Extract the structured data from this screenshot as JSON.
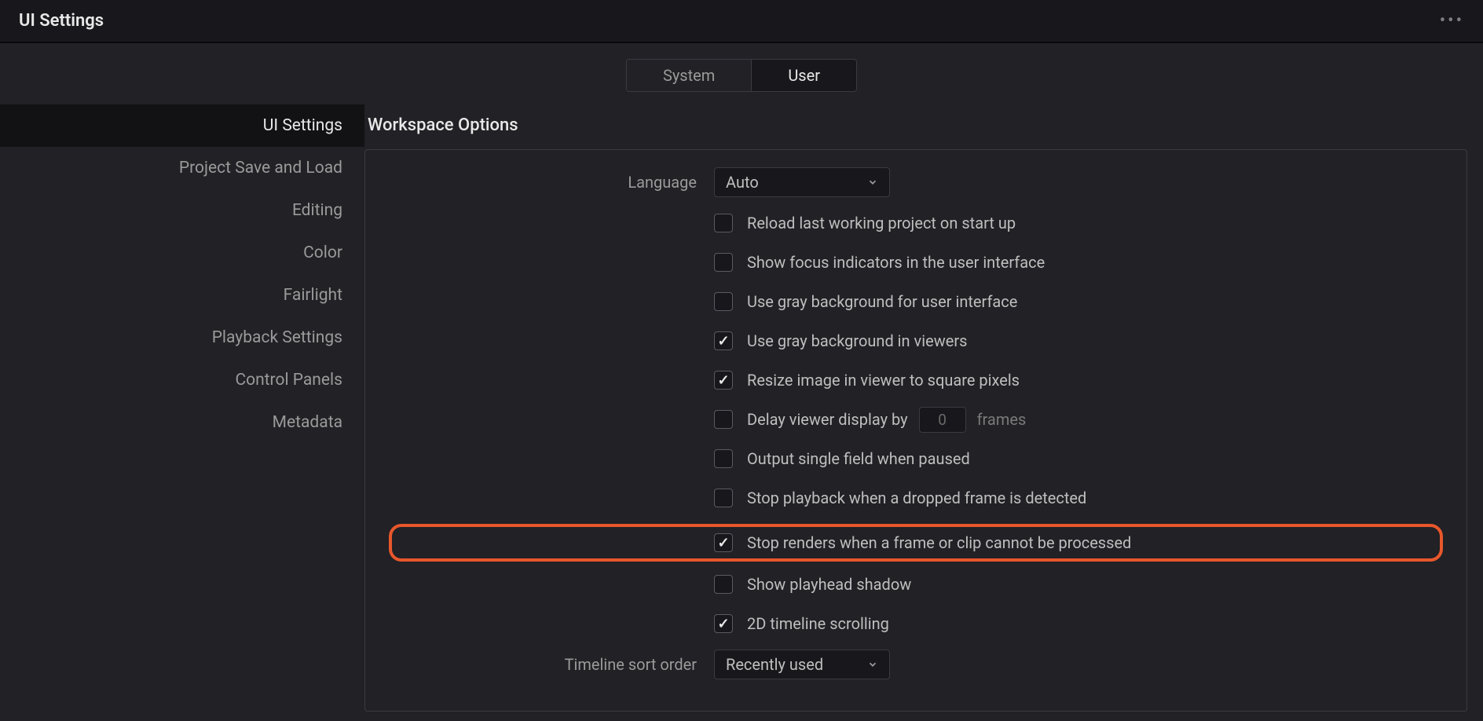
{
  "header": {
    "title": "UI Settings"
  },
  "tabs": {
    "system": "System",
    "user": "User"
  },
  "sidebar": {
    "items": [
      "UI Settings",
      "Project Save and Load",
      "Editing",
      "Color",
      "Fairlight",
      "Playback Settings",
      "Control Panels",
      "Metadata"
    ]
  },
  "content": {
    "section_title": "Workspace Options",
    "language_label": "Language",
    "language_value": "Auto",
    "checkboxes": {
      "reload": "Reload last working project on start up",
      "focus": "Show focus indicators in the user interface",
      "graybg": "Use gray background for user interface",
      "grayviewer": "Use gray background in viewers",
      "resize": "Resize image in viewer to square pixels",
      "delay": "Delay viewer display by",
      "delay_value": "0",
      "delay_suffix": "frames",
      "outputsingle": "Output single field when paused",
      "stopplayback": "Stop playback when a dropped frame is detected",
      "stoprenders": "Stop renders when a frame or clip cannot be processed",
      "playhead": "Show playhead shadow",
      "timeline2d": "2D timeline scrolling"
    },
    "sort_label": "Timeline sort order",
    "sort_value": "Recently used"
  }
}
